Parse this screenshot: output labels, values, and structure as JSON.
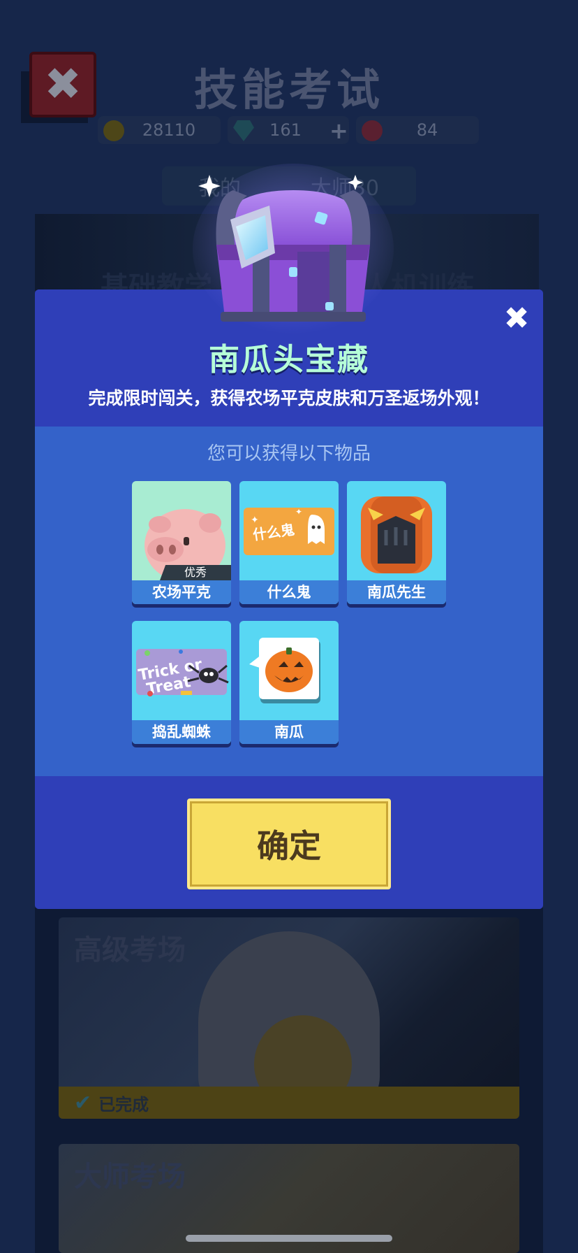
{
  "background": {
    "title": "技能考试",
    "resources": {
      "gold": "28110",
      "gems": "161",
      "tokens": "84"
    },
    "rank_text_left": "我的",
    "rank_text_right": "大师30",
    "banner_left": "基础教学",
    "banner_right": "人机训练",
    "card_advanced_title": "高级考场",
    "card_advanced_status": "已完成",
    "card_master_title": "大师考场"
  },
  "modal": {
    "title": "南瓜头宝藏",
    "subtitle": "完成限时闯关，获得农场平克皮肤和万圣返场外观！",
    "section_label": "您可以获得以下物品",
    "items": [
      {
        "name": "农场平克",
        "tag": "优秀",
        "icon": "pig-icon"
      },
      {
        "name": "什么鬼",
        "art_text": "什么鬼",
        "icon": "ghost-sticker-icon"
      },
      {
        "name": "南瓜先生",
        "icon": "pumpkin-head-icon"
      },
      {
        "name": "捣乱蜘蛛",
        "art_text": "Trick or Treat",
        "icon": "spider-sticker-icon"
      },
      {
        "name": "南瓜",
        "icon": "jack-o-lantern-icon"
      }
    ],
    "confirm_label": "确定",
    "close_icon": "close-icon"
  },
  "colors": {
    "modal_bg": "#2f3fb8",
    "body_bg": "#3462c9",
    "item_bg": "#58d7f3",
    "button_bg": "#f8df62",
    "title_color": "#b6ffd8"
  }
}
